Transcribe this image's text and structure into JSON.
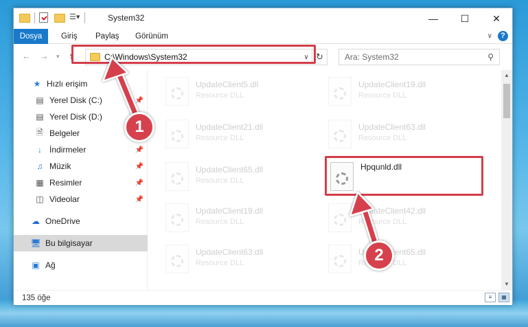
{
  "window": {
    "title": "System32"
  },
  "ribbon": {
    "tabs": [
      "Dosya",
      "Giriş",
      "Paylaş",
      "Görünüm"
    ]
  },
  "address": {
    "path": "C:\\Windows\\System32"
  },
  "search": {
    "placeholder": "Ara: System32"
  },
  "sidebar": {
    "items": [
      {
        "label": "Hızlı erişim",
        "icon": "star-icon",
        "pinned": false
      },
      {
        "label": "Yerel Disk (C:)",
        "icon": "drive-icon",
        "pinned": true
      },
      {
        "label": "Yerel Disk (D:)",
        "icon": "drive-icon",
        "pinned": false
      },
      {
        "label": "Belgeler",
        "icon": "document-icon",
        "pinned": false
      },
      {
        "label": "İndirmeler",
        "icon": "download-icon",
        "pinned": true
      },
      {
        "label": "Müzik",
        "icon": "music-icon",
        "pinned": true
      },
      {
        "label": "Resimler",
        "icon": "picture-icon",
        "pinned": true
      },
      {
        "label": "Videolar",
        "icon": "video-icon",
        "pinned": true
      },
      {
        "label": "OneDrive",
        "icon": "cloud-icon",
        "pinned": false
      },
      {
        "label": "Bu bilgisayar",
        "icon": "computer-icon",
        "pinned": false,
        "selected": true
      },
      {
        "label": "Ağ",
        "icon": "network-icon",
        "pinned": false
      }
    ]
  },
  "files": {
    "left": [
      {
        "name": "UpdateClient5.dll",
        "type": "Resource DLL"
      },
      {
        "name": "UpdateClient21.dll",
        "type": "Resource DLL"
      },
      {
        "name": "UpdateClient65.dll",
        "type": "Resource DLL"
      },
      {
        "name": "UpdateClient19.dll",
        "type": "Resource DLL"
      },
      {
        "name": "UpdateClient63.dll",
        "type": "Resource DLL"
      }
    ],
    "right": [
      {
        "name": "UpdateClient19.dll",
        "type": "Resource DLL"
      },
      {
        "name": "UpdateClient63.dll",
        "type": "Resource DLL"
      },
      {
        "name": "Hpqunld.dll",
        "type": ""
      },
      {
        "name": "UpdateClient42.dll",
        "type": "Resource DLL"
      },
      {
        "name": "UpdateClient65.dll",
        "type": "Resource DLL"
      }
    ]
  },
  "status": {
    "count": "135 öğe"
  },
  "callouts": {
    "one": "1",
    "two": "2",
    "color": "#d6414e"
  }
}
